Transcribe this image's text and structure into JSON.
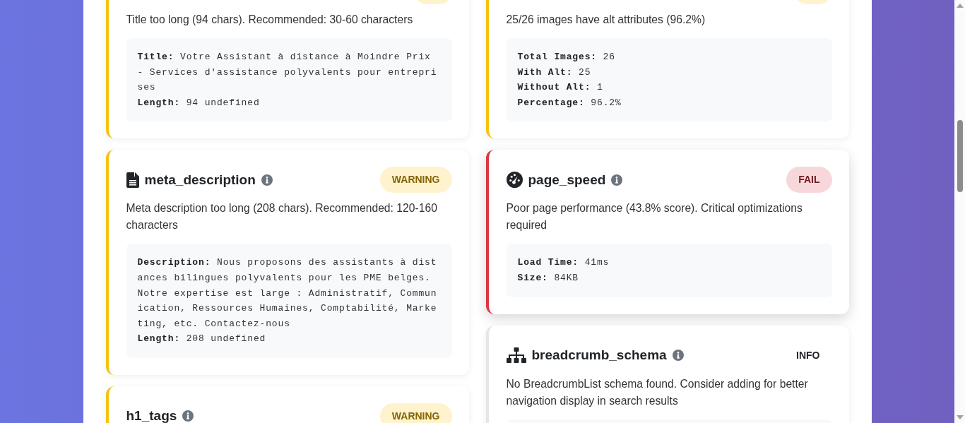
{
  "columns": [
    {
      "cards": [
        {
          "kind": "warning",
          "message": "Title too long (94 chars). Recommended: 30-60 characters",
          "details": [
            {
              "label": "Title:",
              "value": "Votre Assistant à distance à Moindre Prix - Services d'assistance polyvalents pour entreprises"
            },
            {
              "label": "Length:",
              "value": "94 undefined"
            }
          ]
        },
        {
          "kind": "warning",
          "badge": "WARNING",
          "icon": {
            "kind": "file"
          },
          "title": "meta_description",
          "message": "Meta description too long (208 chars). Recommended: 120-160 characters",
          "details": [
            {
              "label": "Description:",
              "value": "Nous proposons des assistants à distances bilingues polyvalents pour les PME belges. Notre expertise est large : Administratif, Communication, Ressources Humaines, Comptabilité, Marketing, etc. Contactez-nous"
            },
            {
              "label": "Length:",
              "value": "208 undefined"
            }
          ]
        },
        {
          "kind": "warning",
          "badge": "WARNING",
          "title": "h1_tags"
        }
      ]
    },
    {
      "cards": [
        {
          "kind": "warning",
          "message": "25/26 images have alt attributes (96.2%)",
          "details": [
            {
              "label": "Total Images:",
              "value": "26"
            },
            {
              "label": "With Alt:",
              "value": "25"
            },
            {
              "label": "Without Alt:",
              "value": "1"
            },
            {
              "label": "Percentage:",
              "value": "96.2%"
            }
          ]
        },
        {
          "kind": "fail",
          "badge": "FAIL",
          "icon": {
            "kind": "gauge"
          },
          "title": "page_speed",
          "message": "Poor page performance (43.8% score). Critical optimizations required",
          "details": [
            {
              "label": "Load Time:",
              "value": "41ms"
            },
            {
              "label": "Size:",
              "value": "84KB"
            }
          ]
        },
        {
          "kind": "info",
          "badge": "INFO",
          "icon": {
            "kind": "sitemap"
          },
          "title": "breadcrumb_schema",
          "message": "No BreadcrumbList schema found. Consider adding for better navigation display in search results"
        }
      ]
    }
  ]
}
